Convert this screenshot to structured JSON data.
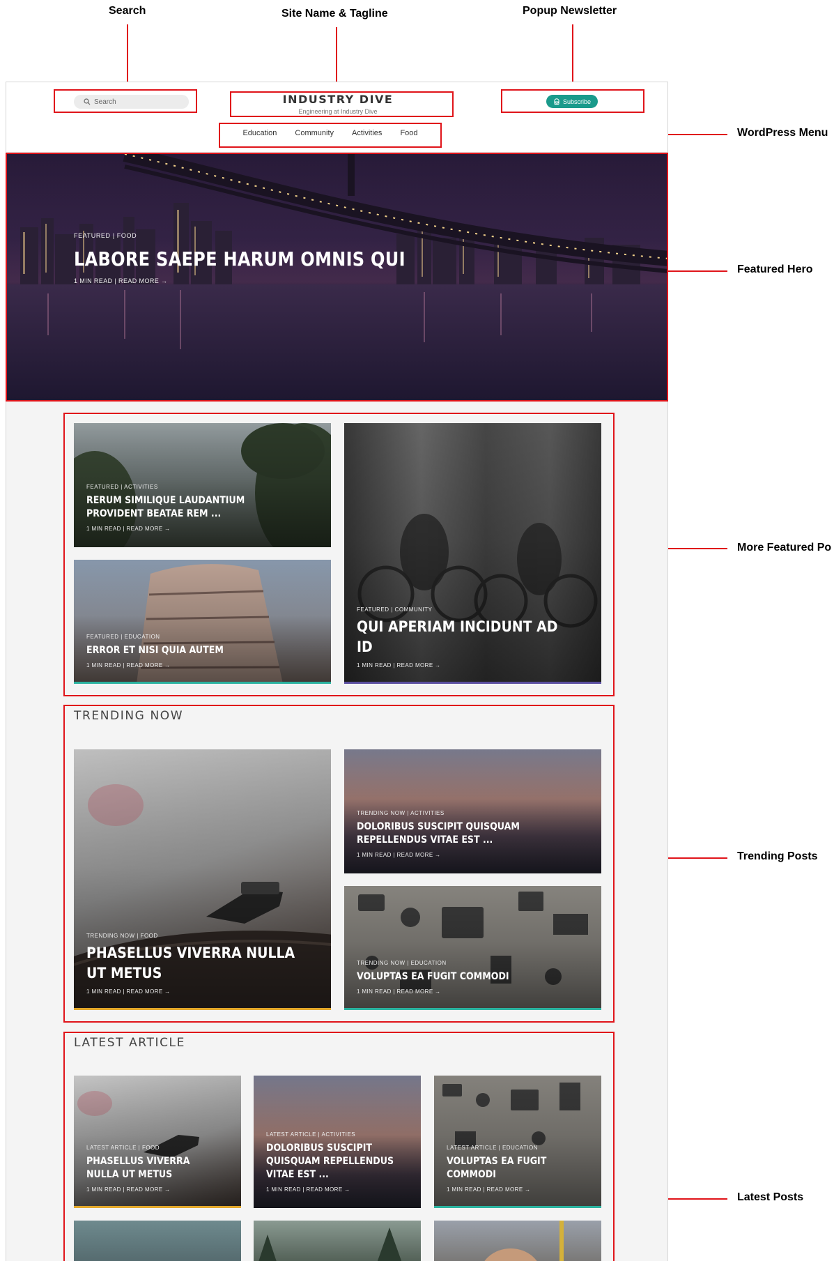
{
  "annotations": {
    "search": "Search",
    "site_name_tagline": "Site Name & Tagline",
    "popup_newsletter": "Popup Newsletter",
    "wordpress_menu": "WordPress Menu",
    "featured_hero": "Featured Hero",
    "more_featured": "More Featured Po",
    "trending_posts": "Trending Posts",
    "latest_posts": "Latest Posts"
  },
  "header": {
    "search_placeholder": "Search",
    "site_name": "INDUSTRY DIVE",
    "tagline": "Engineering at Industry Dive",
    "subscribe_label": "Subscribe",
    "menu": [
      "Education",
      "Community",
      "Activities",
      "Food"
    ]
  },
  "hero": {
    "category": "FEATURED | FOOD",
    "title": "LABORE SAEPE HARUM OMNIS QUI",
    "meta": "1 MIN READ | READ MORE →"
  },
  "featured": [
    {
      "category": "FEATURED | ACTIVITIES",
      "title": "RERUM SIMILIQUE LAUDANTIUM PROVIDENT BEATAE REM ...",
      "meta": "1 MIN READ | READ MORE →",
      "accent": ""
    },
    {
      "category": "FEATURED | EDUCATION",
      "title": "ERROR ET NISI QUIA AUTEM",
      "meta": "1 MIN READ | READ MORE →",
      "accent": "#2bb3a0"
    },
    {
      "category": "FEATURED | COMMUNITY",
      "title": "QUI APERIAM INCIDUNT AD ID",
      "meta": "1 MIN READ | READ MORE →",
      "accent": "#5b4fa0"
    }
  ],
  "trending": {
    "heading": "TRENDING NOW",
    "posts": [
      {
        "category": "TRENDING NOW | FOOD",
        "title": "PHASELLUS VIVERRA NULLA UT METUS",
        "meta": "1 MIN READ | READ MORE →",
        "accent": "#e3a82b"
      },
      {
        "category": "TRENDING NOW | ACTIVITIES",
        "title": "DOLORIBUS SUSCIPIT QUISQUAM REPELLENDUS VITAE EST ...",
        "meta": "1 MIN READ | READ MORE →",
        "accent": ""
      },
      {
        "category": "TRENDING NOW | EDUCATION",
        "title": "VOLUPTAS EA FUGIT COMMODI",
        "meta": "1 MIN READ | READ MORE →",
        "accent": "#2bb3a0"
      }
    ]
  },
  "latest": {
    "heading": "LATEST ARTICLE",
    "posts": [
      {
        "category": "LATEST ARTICLE | FOOD",
        "title": "PHASELLUS VIVERRA NULLA UT METUS",
        "meta": "1 MIN READ | READ MORE →",
        "accent": "#e3a82b"
      },
      {
        "category": "LATEST ARTICLE | ACTIVITIES",
        "title": "DOLORIBUS SUSCIPIT QUISQUAM REPELLENDUS VITAE EST ...",
        "meta": "1 MIN READ | READ MORE →",
        "accent": ""
      },
      {
        "category": "LATEST ARTICLE | EDUCATION",
        "title": "VOLUPTAS EA FUGIT COMMODI",
        "meta": "1 MIN READ | READ MORE →",
        "accent": "#2bb3a0"
      }
    ]
  },
  "colors": {
    "annotation_red": "#e0141a",
    "subscribe_bg": "#1a9a8b",
    "page_bg": "#f4f4f4"
  }
}
